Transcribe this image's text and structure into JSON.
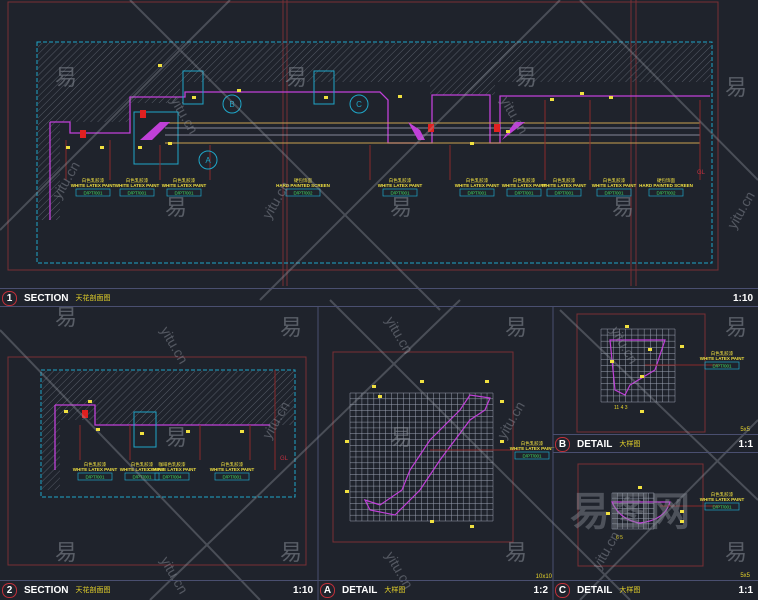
{
  "panels": [
    {
      "id": "1",
      "type": "SECTION",
      "subtitle": "天花剖面图",
      "scale": "1:10"
    },
    {
      "id": "2",
      "type": "SECTION",
      "subtitle": "天花剖面图",
      "scale": "1:10"
    },
    {
      "id": "A",
      "type": "DETAIL",
      "subtitle": "大样图",
      "scale": "1:2"
    },
    {
      "id": "B",
      "type": "DETAIL",
      "subtitle": "大样图",
      "scale": "1:1"
    },
    {
      "id": "C",
      "type": "DETAIL",
      "subtitle": "大样图",
      "scale": "1:1"
    }
  ],
  "section1": {
    "callouts": [
      "A",
      "B",
      "C"
    ],
    "gl": "GL",
    "labels": [
      {
        "cn": "白色乳胶漆",
        "en": "WHITE LATEX PAINT",
        "code": "D/PT/001"
      },
      {
        "cn": "白色乳胶漆",
        "en": "WHITE LATEX PAINT",
        "code": "D/PT/001"
      },
      {
        "cn": "白色乳胶漆",
        "en": "WHITE LATEX PAINT",
        "code": "D/PT/001"
      },
      {
        "cn": "硬包饰面",
        "en": "HARD PAINTED SCREEN",
        "code": "D/PT/002"
      },
      {
        "cn": "白色乳胶漆",
        "en": "WHITE LATEX PAINT",
        "code": "D/PT/001"
      },
      {
        "cn": "白色乳胶漆",
        "en": "WHITE LATEX PAINT",
        "code": "D/PT/001"
      },
      {
        "cn": "白色乳胶漆",
        "en": "WHITE LATEX PAINT",
        "code": "D/PT/001"
      },
      {
        "cn": "白色乳胶漆",
        "en": "WHITE LATEX PAINT",
        "code": "D/PT/001"
      },
      {
        "cn": "白色乳胶漆",
        "en": "WHITE LATEX PAINT",
        "code": "D/PT/001"
      },
      {
        "cn": "硬包饰面",
        "en": "HARD PAINTED SCREEN",
        "code": "D/PT/002"
      }
    ]
  },
  "section2": {
    "gl": "GL",
    "labels": [
      {
        "cn": "白色乳胶漆",
        "en": "WHITE LATEX PAINT",
        "code": "D/PT/001"
      },
      {
        "cn": "白色乳胶漆",
        "en": "WHITE LATEX PAINT",
        "code": "D/PT/001"
      },
      {
        "cn": "咖啡色乳胶漆",
        "en": "COFFEE LATEX PAINT",
        "code": "D/PT/004"
      },
      {
        "cn": "白色乳胶漆",
        "en": "WHITE LATEX PAINT",
        "code": "D/PT/001"
      }
    ]
  },
  "detailA": {
    "grid": "10x10",
    "label": {
      "cn": "白色乳胶漆",
      "en": "WHITE LATEX PAINT",
      "code": "D/PT/001"
    }
  },
  "detailB": {
    "grid": "5x5",
    "dims": "11 4 3",
    "label": {
      "cn": "白色乳胶漆",
      "en": "WHITE LATEX PAINT",
      "code": "D/PT/001"
    }
  },
  "detailC": {
    "grid": "5x5",
    "dims": "6 5",
    "label": {
      "cn": "白色乳胶漆",
      "en": "WHITE LATEX PAINT",
      "code": "D/PT/001"
    }
  },
  "watermark": {
    "mark": "易",
    "site": "yitu.cn",
    "brand": "易图网"
  },
  "colors": {
    "bg": "#1f232c",
    "frame": "#8a3a3f",
    "cyan": "#1fa6c8",
    "magenta": "#c040d8",
    "yellow": "#f0e040",
    "green": "#40e060",
    "red": "#e02020"
  }
}
